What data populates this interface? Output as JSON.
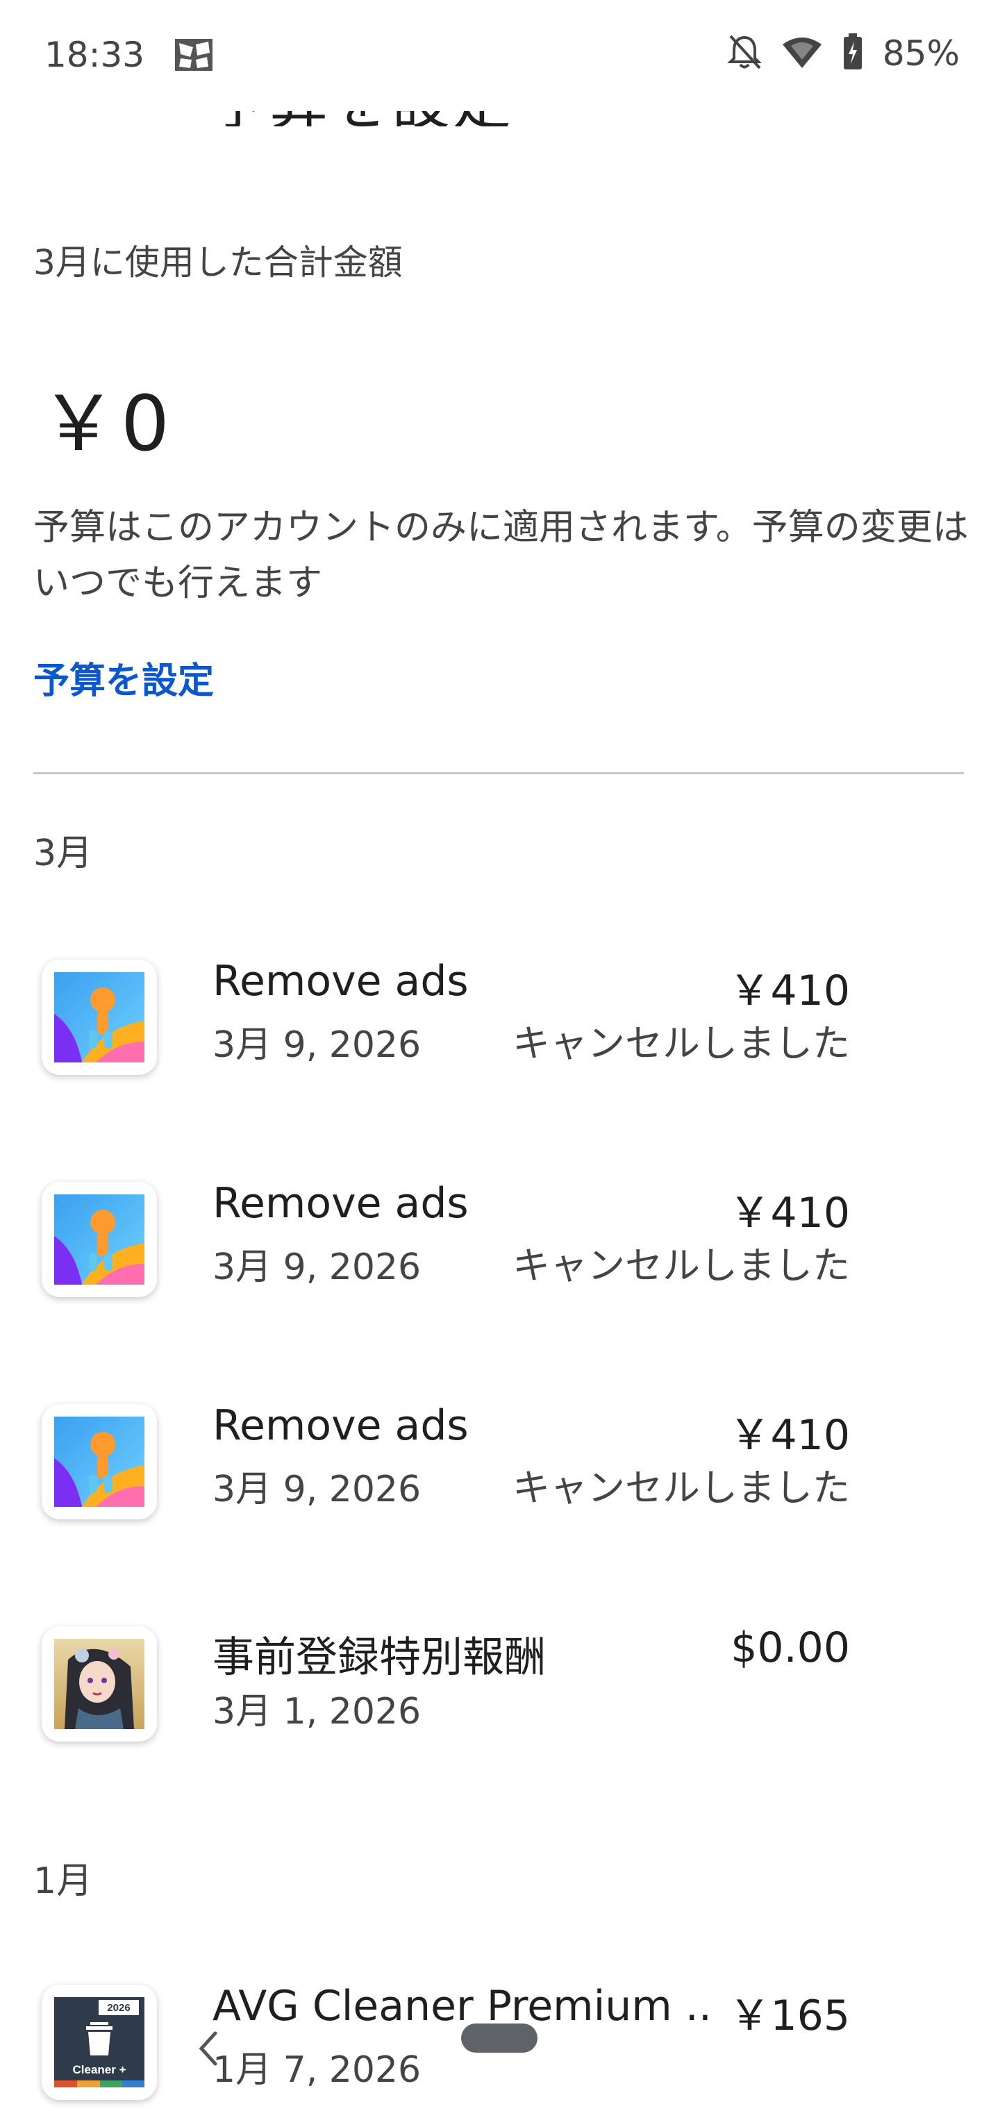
{
  "status_bar": {
    "time": "18:33",
    "battery": "85%",
    "icons": [
      "app-notification-icon",
      "bell-off-icon",
      "wifi-icon",
      "battery-charging-icon"
    ]
  },
  "header": {
    "title_clipped": "予算を設定"
  },
  "summary": {
    "label": "3月に使用した合計金額",
    "total": "￥0",
    "description": "予算はこのアカウントのみに適用されます。予算の変更はいつでも行えます",
    "set_budget_link": "予算を設定"
  },
  "sections": [
    {
      "month": "3月",
      "items": [
        {
          "title": "Remove ads",
          "date": "3月 9, 2026",
          "amount": "￥410",
          "status": "キャンセルしました",
          "icon": "game-runner-icon"
        },
        {
          "title": "Remove ads",
          "date": "3月 9, 2026",
          "amount": "￥410",
          "status": "キャンセルしました",
          "icon": "game-runner-icon"
        },
        {
          "title": "Remove ads",
          "date": "3月 9, 2026",
          "amount": "￥410",
          "status": "キャンセルしました",
          "icon": "game-runner-icon"
        },
        {
          "title": "事前登録特別報酬",
          "date": "3月 1, 2026",
          "amount": "$0.00",
          "status": "",
          "icon": "anime-character-icon"
        }
      ]
    },
    {
      "month": "1月",
      "items": [
        {
          "title": "AVG Cleaner Premium ...",
          "date": "1月 7, 2026",
          "amount": "￥165",
          "status": "",
          "icon": "avg-cleaner-icon",
          "icon_text": {
            "year": "2026",
            "label": "Cleaner +"
          }
        }
      ]
    }
  ],
  "colors": {
    "link": "#0b57d0",
    "divider": "#c4c7c5",
    "text_primary": "#1f1f1f",
    "text_secondary": "#444444"
  }
}
